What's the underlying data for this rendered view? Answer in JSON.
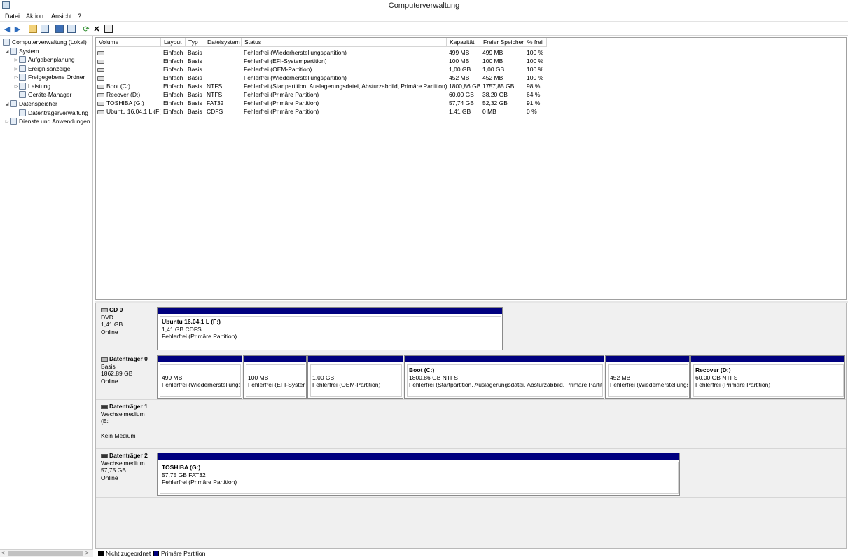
{
  "window": {
    "title": "Computerverwaltung"
  },
  "menu": {
    "items": [
      "Datei",
      "Aktion",
      "Ansicht",
      "?"
    ]
  },
  "tree": {
    "items": [
      {
        "label": "Computerverwaltung (Lokal)",
        "level": 0,
        "expander": ""
      },
      {
        "label": "System",
        "level": 1,
        "expander": "◢"
      },
      {
        "label": "Aufgabenplanung",
        "level": 2,
        "expander": "▷"
      },
      {
        "label": "Ereignisanzeige",
        "level": 2,
        "expander": "▷"
      },
      {
        "label": "Freigegebene Ordner",
        "level": 2,
        "expander": "▷"
      },
      {
        "label": "Leistung",
        "level": 2,
        "expander": "▷"
      },
      {
        "label": "Geräte-Manager",
        "level": 2,
        "expander": ""
      },
      {
        "label": "Datenspeicher",
        "level": 1,
        "expander": "◢"
      },
      {
        "label": "Datenträgerverwaltung",
        "level": 2,
        "expander": ""
      },
      {
        "label": "Dienste und Anwendungen",
        "level": 1,
        "expander": "▷"
      }
    ]
  },
  "volumes": {
    "columns": [
      "Volume",
      "Layout",
      "Typ",
      "Dateisystem",
      "Status",
      "Kapazität",
      "Freier Speicher",
      "% frei"
    ],
    "rows": [
      [
        "",
        "Einfach",
        "Basis",
        "",
        "Fehlerfrei (Wiederherstellungspartition)",
        "499 MB",
        "499 MB",
        "100 %"
      ],
      [
        "",
        "Einfach",
        "Basis",
        "",
        "Fehlerfrei (EFI-Systempartition)",
        "100 MB",
        "100 MB",
        "100 %"
      ],
      [
        "",
        "Einfach",
        "Basis",
        "",
        "Fehlerfrei (OEM-Partition)",
        "1,00 GB",
        "1,00 GB",
        "100 %"
      ],
      [
        "",
        "Einfach",
        "Basis",
        "",
        "Fehlerfrei (Wiederherstellungspartition)",
        "452 MB",
        "452 MB",
        "100 %"
      ],
      [
        "Boot (C:)",
        "Einfach",
        "Basis",
        "NTFS",
        "Fehlerfrei (Startpartition, Auslagerungsdatei, Absturzabbild, Primäre Partition)",
        "1800,86 GB",
        "1757,85 GB",
        "98 %"
      ],
      [
        "Recover (D:)",
        "Einfach",
        "Basis",
        "NTFS",
        "Fehlerfrei (Primäre Partition)",
        "60,00 GB",
        "38,20 GB",
        "64 %"
      ],
      [
        "TOSHIBA (G:)",
        "Einfach",
        "Basis",
        "FAT32",
        "Fehlerfrei (Primäre Partition)",
        "57,74 GB",
        "52,32 GB",
        "91 %"
      ],
      [
        "Ubuntu 16.04.1 L (F:)",
        "Einfach",
        "Basis",
        "CDFS",
        "Fehlerfrei (Primäre Partition)",
        "1,41 GB",
        "0 MB",
        "0 %"
      ]
    ]
  },
  "disks": {
    "cd0": {
      "name": "CD 0",
      "type": "DVD",
      "size": "1,41 GB",
      "state": "Online",
      "partitions": [
        {
          "name": "Ubuntu 16.04.1 L  (F:)",
          "line2": "1,41 GB CDFS",
          "line3": "Fehlerfrei (Primäre Partition)"
        }
      ]
    },
    "disk0": {
      "name": "Datenträger 0",
      "type": "Basis",
      "size": "1862,89 GB",
      "state": "Online",
      "partitions": [
        {
          "name": "",
          "line2": "499 MB",
          "line3": "Fehlerfrei (Wiederherstellungsp"
        },
        {
          "name": "",
          "line2": "100 MB",
          "line3": "Fehlerfrei (EFI-System"
        },
        {
          "name": "",
          "line2": "1,00 GB",
          "line3": "Fehlerfrei (OEM-Partition)"
        },
        {
          "name": "Boot  (C:)",
          "line2": "1800,86 GB NTFS",
          "line3": "Fehlerfrei (Startpartition, Auslagerungsdatei, Absturzabbild, Primäre Partitic"
        },
        {
          "name": "",
          "line2": "452 MB",
          "line3": "Fehlerfrei (Wiederherstellungs"
        },
        {
          "name": "Recover  (D:)",
          "line2": "60,00 GB NTFS",
          "line3": "Fehlerfrei (Primäre Partition)"
        }
      ]
    },
    "disk1": {
      "name": "Datenträger 1",
      "type": "Wechselmedium (E:",
      "size": "",
      "state": "Kein Medium"
    },
    "disk2": {
      "name": "Datenträger 2",
      "type": "Wechselmedium",
      "size": "57,75 GB",
      "state": "Online",
      "partitions": [
        {
          "name": "TOSHIBA  (G:)",
          "line2": "57,75 GB FAT32",
          "line3": "Fehlerfrei (Primäre Partition)"
        }
      ]
    }
  },
  "legend": {
    "unallocated": "Nicht zugeordnet",
    "primary": "Primäre Partition"
  },
  "colors": {
    "primary_partition": "#00007f",
    "unallocated": "#000000"
  }
}
